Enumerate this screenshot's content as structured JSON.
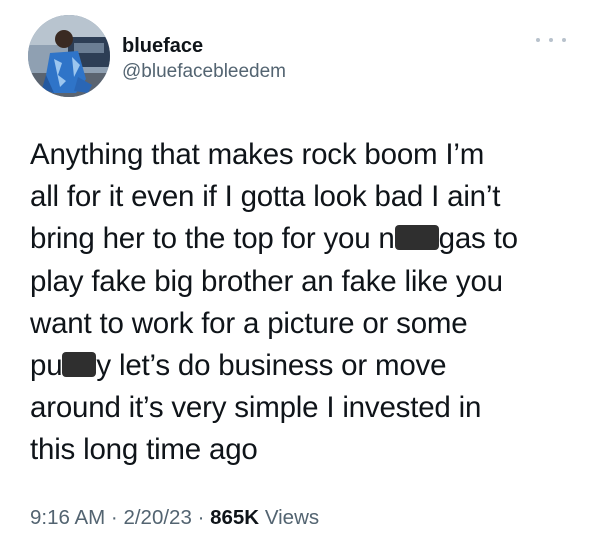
{
  "tweet": {
    "author": {
      "display_name": "blueface",
      "handle": "@bluefacebleedem",
      "avatar_icon": "user-avatar-photo"
    },
    "more_icon": "more-dots-icon",
    "text_lines": [
      "Anything that makes rock boom I’m",
      "all for it even if I gotta look bad I ain’t",
      [
        "bring her to the top for you n",
        "gas to"
      ],
      "play fake big brother an fake like you",
      "want to work for a picture or some",
      [
        "pu",
        "y let’s do business or move"
      ],
      "around it’s very simple I invested in",
      "this long time ago"
    ],
    "meta": {
      "time": "9:16 AM",
      "separator": "·",
      "date": "2/20/23",
      "views_count": "865K",
      "views_label": "Views"
    }
  }
}
